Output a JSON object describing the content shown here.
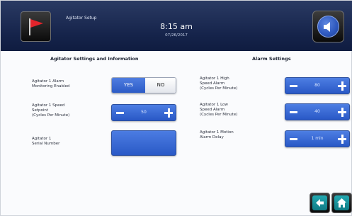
{
  "header": {
    "screen_title": "Agitator Setup",
    "time": "8:15 am",
    "date": "07/26/2017",
    "flag_icon": "flag-icon",
    "sound_icon": "speaker-icon"
  },
  "left_section": {
    "title": "Agitator Settings and Information",
    "alarm_monitoring": {
      "label_line1": "Agitator 1 Alarm",
      "label_line2": "Monitoring Enabled",
      "yes_label": "YES",
      "no_label": "NO",
      "selected": "YES"
    },
    "speed_setpoint": {
      "label_line1": "Agitator 1 Speed",
      "label_line2": "Setpoint",
      "label_line3": "(Cycles Per Minute)",
      "value": "50"
    },
    "serial_number": {
      "label_line1": "Agitator 1",
      "label_line2": "Serial Number",
      "value": ""
    }
  },
  "right_section": {
    "title": "Alarm Settings",
    "high_speed_alarm": {
      "label_line1": "Agitator 1 High",
      "label_line2": "Speed Alarm",
      "label_line3": "(Cycles Per Minute)",
      "value": "80"
    },
    "low_speed_alarm": {
      "label_line1": "Agitator 1 Low",
      "label_line2": "Speed Alarm",
      "label_line3": "(Cycles Per Minute)",
      "value": "40"
    },
    "motion_alarm_delay": {
      "label_line1": "Agitator 1 Motion",
      "label_line2": "Alarm Delay",
      "value": "1 min"
    }
  },
  "footer": {
    "back_icon": "back-arrow-icon",
    "home_icon": "home-icon"
  },
  "colors": {
    "header_bg": "#15234a",
    "accent_blue": "#2d5bc6",
    "teal": "#1597a1"
  }
}
